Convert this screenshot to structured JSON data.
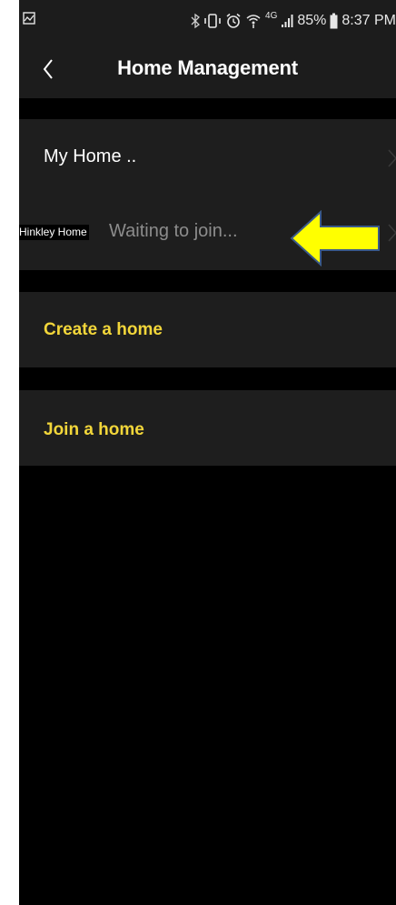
{
  "status_bar": {
    "battery": "85%",
    "time": "8:37 PM",
    "network": "4G",
    "left_icon": "image-icon",
    "icons": [
      "bluetooth-icon",
      "vibrate-icon",
      "alarm-icon",
      "wifi-calling-icon",
      "signal-icon",
      "battery-icon"
    ]
  },
  "nav": {
    "title": "Home Management",
    "back_icon": "back-chevron-icon"
  },
  "homes": [
    {
      "label": "My Home ..",
      "chevron": "chevron-right-icon"
    },
    {
      "overlay_label": "Hinkley Home",
      "status": "Waiting to join...",
      "chevron": "chevron-right-icon",
      "annotation": "yellow-arrow-icon"
    }
  ],
  "actions": {
    "create": "Create a home",
    "join": "Join a home"
  },
  "colors": {
    "background": "#000000",
    "card": "#1e1e1e",
    "header": "#1c1c1c",
    "accent": "#f2d63a",
    "muted": "#8c8c8c",
    "annotation_arrow": "#ffff00"
  }
}
